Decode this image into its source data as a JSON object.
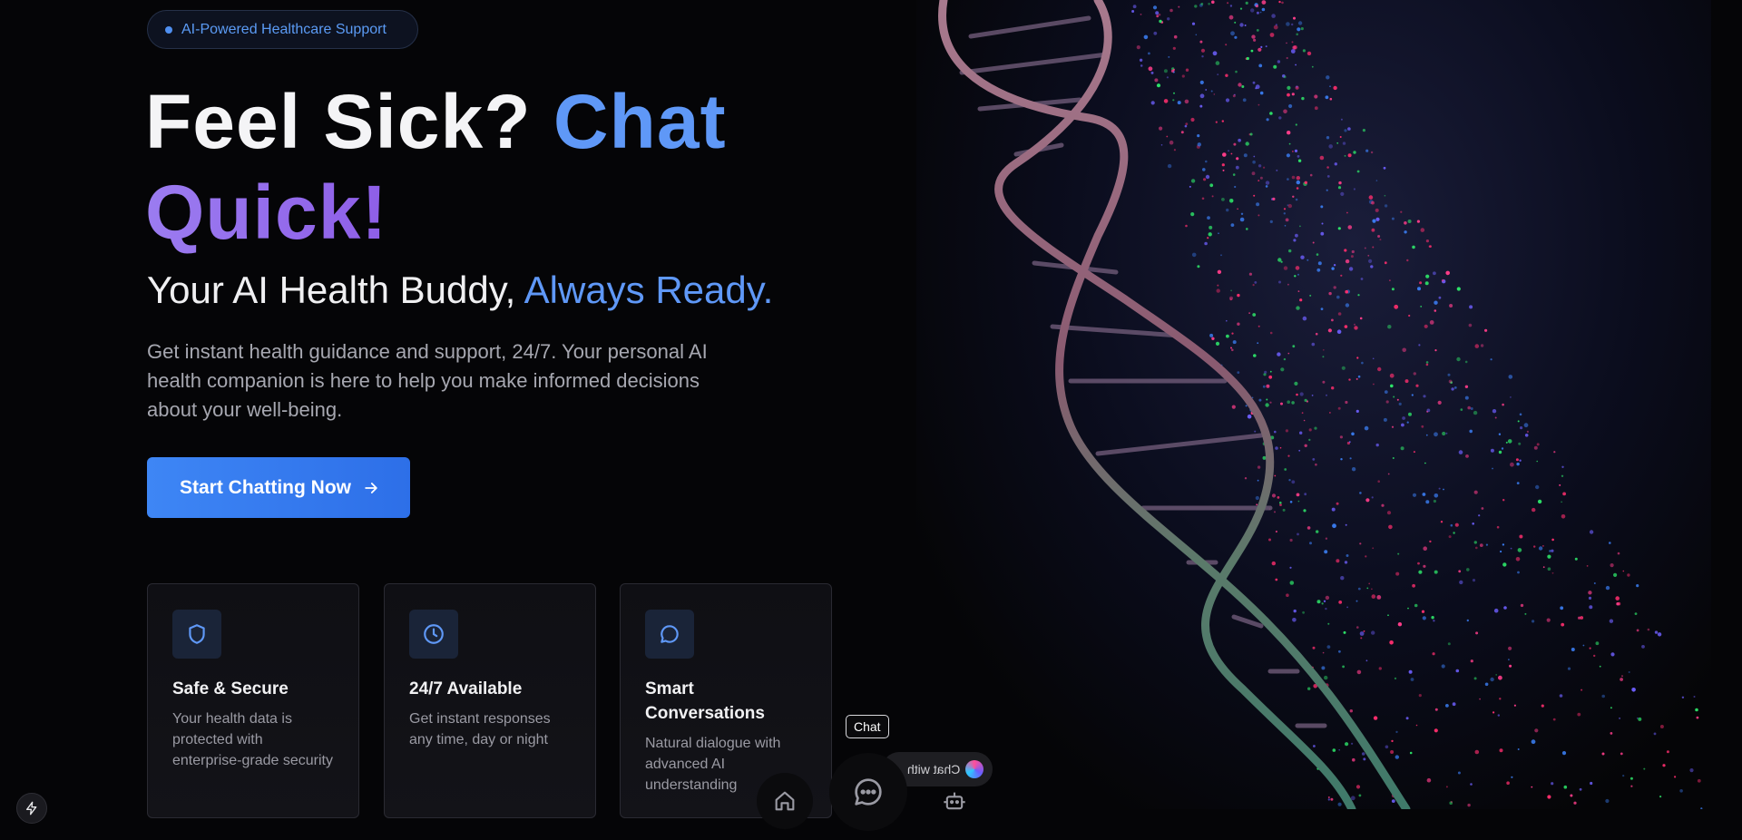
{
  "badge": {
    "label": "AI-Powered Healthcare Support"
  },
  "hero": {
    "headline_part1": "Feel Sick?",
    "headline_part2": "Chat",
    "headline_part3": "Quick!",
    "subhead_part1": "Your AI Health Buddy,",
    "subhead_part2": "Always Ready.",
    "description": "Get instant health guidance and support, 24/7. Your personal AI health companion is here to help you make informed decisions about your well-being.",
    "cta_label": "Start Chatting Now"
  },
  "features": [
    {
      "icon": "shield-icon",
      "title": "Safe & Secure",
      "description": "Your health data is protected with enterprise-grade security"
    },
    {
      "icon": "clock-icon",
      "title": "24/7 Available",
      "description": "Get instant responses any time, day or night"
    },
    {
      "icon": "chat-bubble-icon",
      "title": "Smart Conversations",
      "description": "Natural dialogue with advanced AI understanding"
    }
  ],
  "dock": {
    "tooltip": "Chat",
    "pill_text": "Chat with",
    "items": [
      "home-icon",
      "chat-icon",
      "robot-icon"
    ]
  },
  "colors": {
    "accent_blue": "#5f98f7",
    "accent_purple": "#9b7cf0",
    "cta_blue": "#3e86f5",
    "background": "#050507"
  }
}
